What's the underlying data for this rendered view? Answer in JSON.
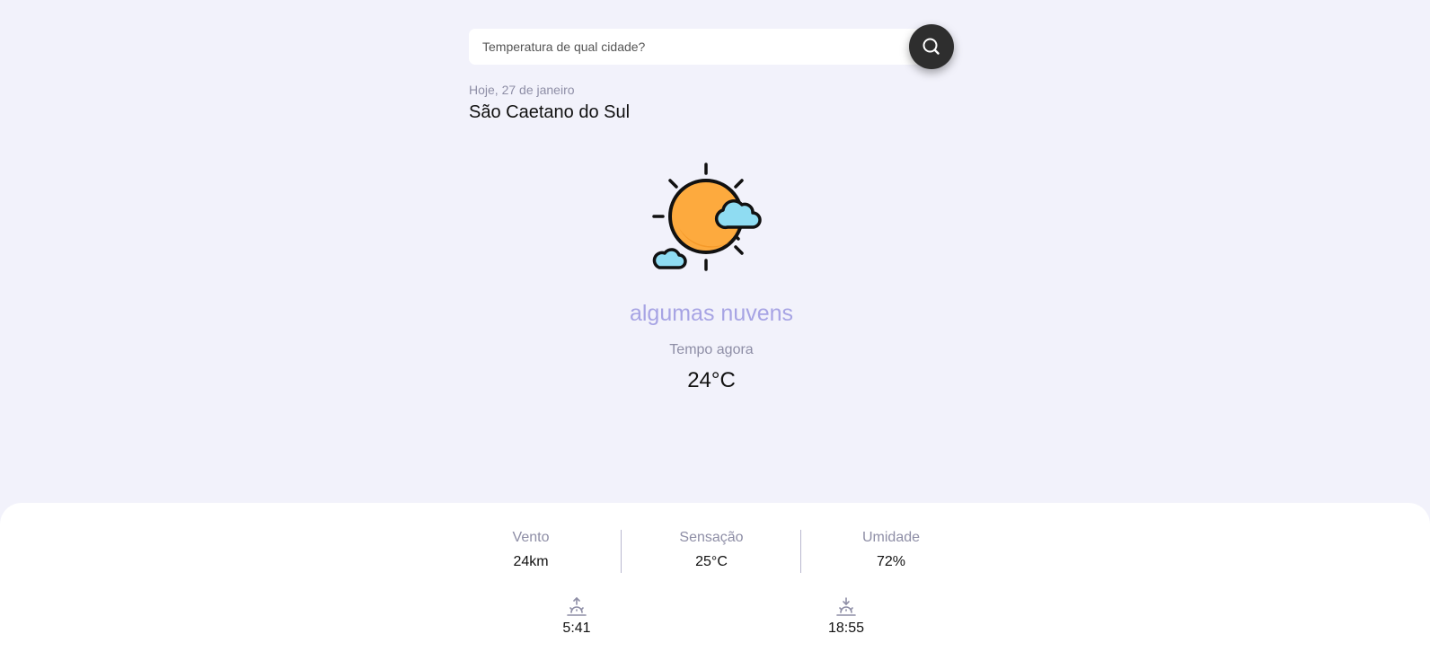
{
  "search": {
    "placeholder": "Temperatura de qual cidade?",
    "value": "",
    "button_icon": "search-icon"
  },
  "location": {
    "date": "Hoje, 27 de janeiro",
    "city": "São Caetano do Sul"
  },
  "current": {
    "icon": "sun-with-clouds-icon",
    "condition": "algumas nuvens",
    "label": "Tempo agora",
    "temperature": "24°C"
  },
  "stats": [
    {
      "label": "Vento",
      "value": "24km"
    },
    {
      "label": "Sensação",
      "value": "25°C"
    },
    {
      "label": "Umidade",
      "value": "72%"
    }
  ],
  "sun": {
    "sunrise_icon": "sunrise-icon",
    "sunrise": "5:41",
    "sunset_icon": "sunset-icon",
    "sunset": "18:55"
  },
  "colors": {
    "background": "#f2f2fb",
    "accent": "#a7a4e4",
    "muted_text": "#8e8ea6",
    "search_button": "#2e2e2e",
    "sun": "#fdaa3e",
    "cloud": "#8fdcf2"
  }
}
